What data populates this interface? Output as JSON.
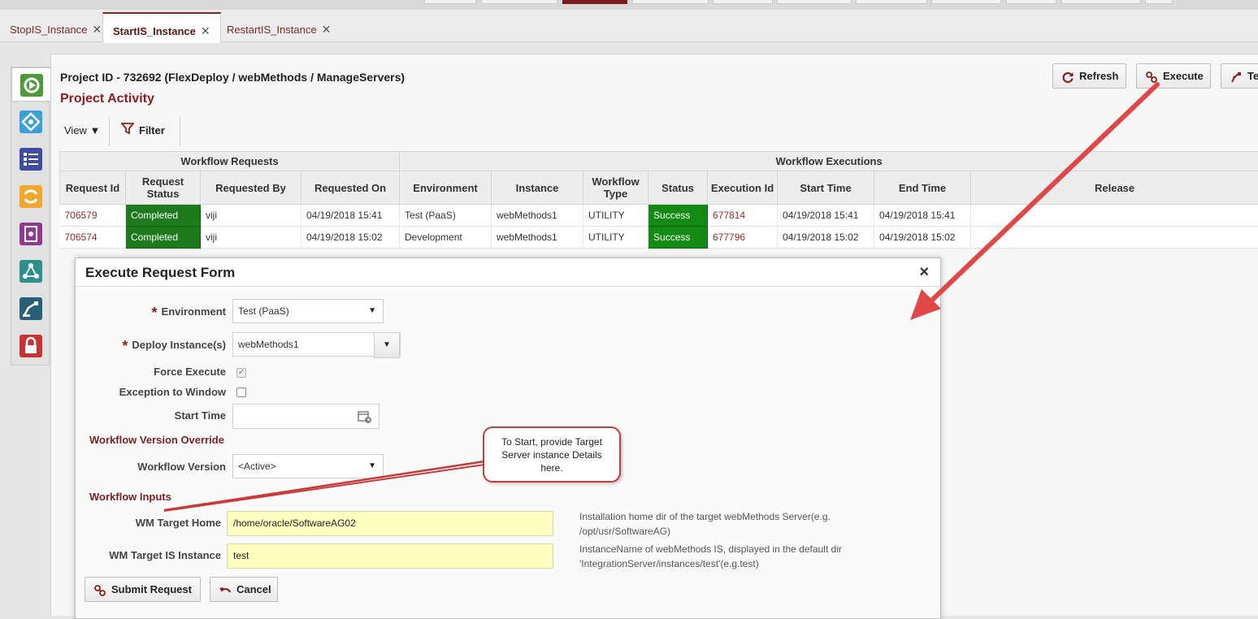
{
  "tabs": [
    {
      "label": "StopIS_Instance",
      "close": "✕"
    },
    {
      "label": "StartIS_Instance",
      "close": "✕"
    },
    {
      "label": "RestartIS_Instance",
      "close": "✕"
    }
  ],
  "sidebar": {
    "icons": [
      "workflow-gear-icon",
      "integration-icon",
      "checklist-icon",
      "sync-icon",
      "report-icon",
      "topology-icon",
      "robot-icon",
      "lock-icon"
    ]
  },
  "header": {
    "project_title": "Project ID - 732692 (FlexDeploy / webMethods / ManageServers)",
    "activity_title": "Project Activity",
    "refresh_label": "Refresh",
    "execute_label": "Execute",
    "third_label": "Te"
  },
  "toolbar": {
    "view_label": "View ▼",
    "filter_label": "Filter"
  },
  "grid": {
    "group_requests": "Workflow Requests",
    "group_executions": "Workflow Executions",
    "columns": [
      "Request Id",
      "Request Status",
      "Requested By",
      "Requested On",
      "Environment",
      "Instance",
      "Workflow Type",
      "Status",
      "Execution Id",
      "Start Time",
      "End Time",
      "Release"
    ],
    "rows": [
      {
        "request_id": "706579",
        "request_status": "Completed",
        "requested_by": "viji",
        "requested_on": "04/19/2018 15:41",
        "environment": "Test (PaaS)",
        "instance": "webMethods1",
        "workflow_type": "UTILITY",
        "status": "Success",
        "execution_id": "677814",
        "start_time": "04/19/2018 15:41",
        "end_time": "04/19/2018 15:41",
        "release": ""
      },
      {
        "request_id": "706574",
        "request_status": "Completed",
        "requested_by": "viji",
        "requested_on": "04/19/2018 15:02",
        "environment": "Development",
        "instance": "webMethods1",
        "workflow_type": "UTILITY",
        "status": "Success",
        "execution_id": "677796",
        "start_time": "04/19/2018 15:02",
        "end_time": "04/19/2018 15:02",
        "release": ""
      }
    ]
  },
  "dialog": {
    "title": "Execute Request Form",
    "close": "×",
    "required_mark": "*",
    "environment_label": "Environment",
    "environment_value": "Test (PaaS)",
    "deploy_instances_label": "Deploy Instance(s)",
    "deploy_instances_value": "webMethods1",
    "force_execute_label": "Force Execute",
    "force_execute_checked": true,
    "exception_label": "Exception to Window",
    "exception_checked": false,
    "start_time_label": "Start Time",
    "start_time_value": "",
    "version_override_section": "Workflow Version Override",
    "workflow_version_label": "Workflow Version",
    "workflow_version_value": "<Active>",
    "inputs_section": "Workflow Inputs",
    "wm_home_label": "WM Target Home",
    "wm_home_value": "/home/oracle/SoftwareAG02",
    "wm_home_help_1": "Installation home dir of the target webMethods Server(e.g.",
    "wm_home_help_2": "/opt/usr/SoftwareAG)",
    "wm_instance_label": "WM Target IS Instance",
    "wm_instance_value": "test",
    "wm_instance_help_1": "InstanceName of webMethods IS, displayed in the default dir",
    "wm_instance_help_2": "'IntegrationServer/instances/test'(e.g.test)",
    "submit_label": "Submit Request",
    "cancel_label": "Cancel"
  },
  "callout": {
    "line1": "To Start, provide Target",
    "line2": "Server instance Details",
    "line3": "here."
  },
  "colors": {
    "brand": "#8b1f1f",
    "completed": "#1d7a1d",
    "success": "#138a13",
    "input_highlight": "#ffffc2",
    "annotation_red": "#e04848"
  }
}
